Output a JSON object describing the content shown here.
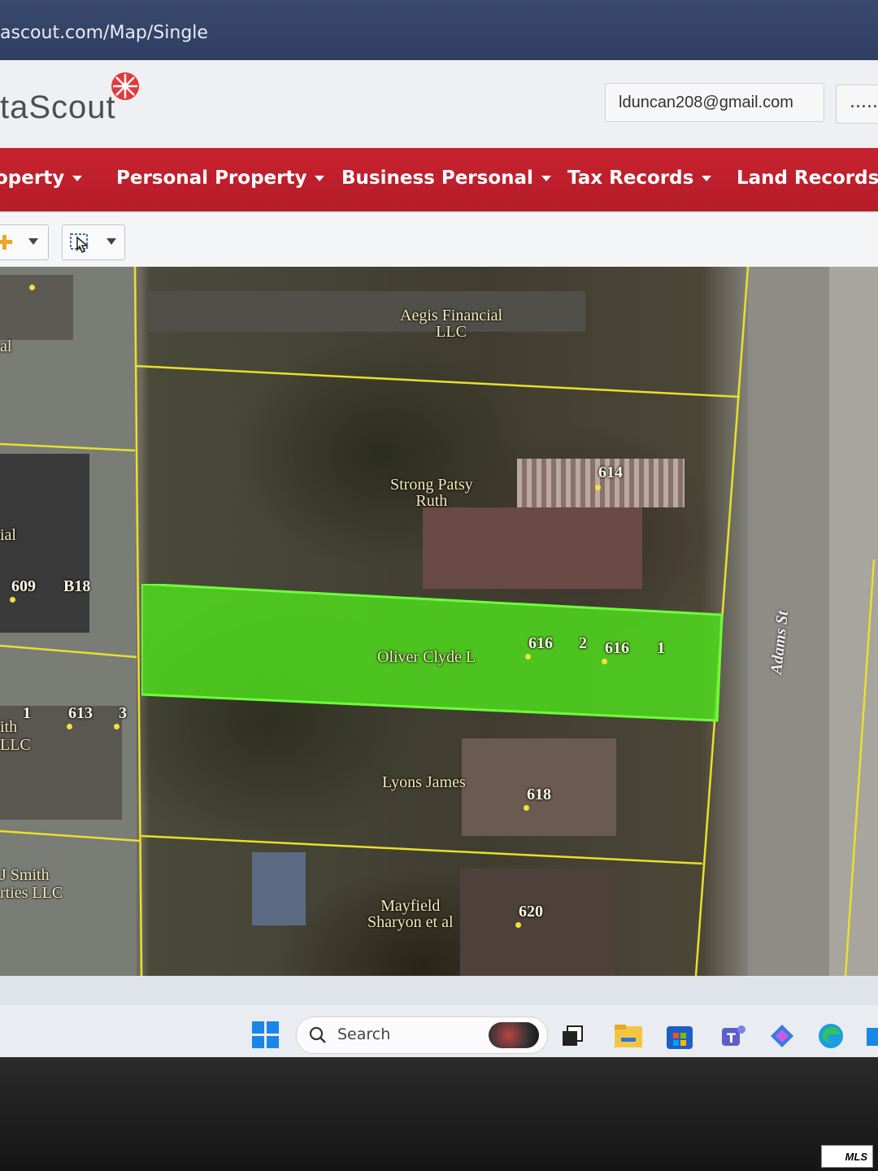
{
  "browser": {
    "url": "ascout.com/Map/Single"
  },
  "header": {
    "logo_text": "taScout",
    "email": "lduncan208@gmail.com",
    "more": "....."
  },
  "nav": {
    "items": [
      {
        "label": "operty"
      },
      {
        "label": "Personal Property"
      },
      {
        "label": "Business Personal"
      },
      {
        "label": "Tax Records"
      },
      {
        "label": "Land Records"
      }
    ]
  },
  "map": {
    "owners": {
      "aegis_1": "Aegis Financial",
      "aegis_2": "LLC",
      "strong_1": "Strong Patsy",
      "strong_2": "Ruth",
      "oliver": "Oliver Clyde L",
      "lyons": "Lyons James",
      "mayfield_1": "Mayfield",
      "mayfield_2": "Sharyon et al",
      "left_1": "al",
      "left_2": "ial",
      "ith": "ith",
      "llc_left": "LLC",
      "smith": "J Smith",
      "rties": "rties LLC"
    },
    "numbers": {
      "n614": "614",
      "n616a": "616",
      "n2": "2",
      "n616b": "616",
      "n1": "1",
      "n618": "618",
      "n620": "620",
      "n609": "609",
      "b18": "B18",
      "n613": "613",
      "n3": "3",
      "n1_left": "1"
    },
    "street": "Adams St"
  },
  "taskbar": {
    "search_label": "Search"
  },
  "badge": {
    "mls": "MLS"
  }
}
